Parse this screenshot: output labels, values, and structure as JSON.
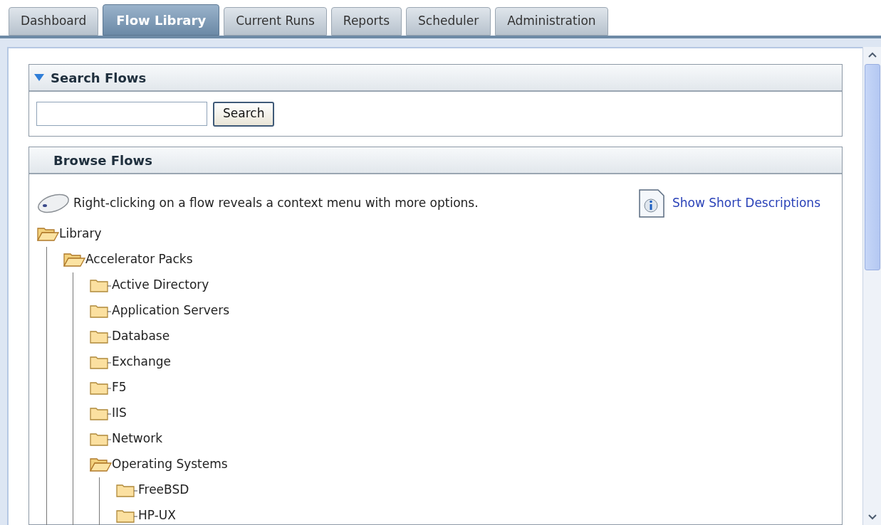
{
  "tabs": [
    {
      "label": "Dashboard",
      "selected": false
    },
    {
      "label": "Flow Library",
      "selected": true
    },
    {
      "label": "Current Runs",
      "selected": false
    },
    {
      "label": "Reports",
      "selected": false
    },
    {
      "label": "Scheduler",
      "selected": false
    },
    {
      "label": "Administration",
      "selected": false
    }
  ],
  "search_panel": {
    "title": "Search Flows",
    "expanded": true,
    "button": "Search"
  },
  "browse_panel": {
    "title": "Browse Flows",
    "hint": "Right-clicking on a flow reveals a context menu with more options.",
    "link": "Show Short Descriptions",
    "tree": [
      {
        "label": "Library",
        "expanded": true,
        "children": [
          {
            "label": "Accelerator Packs",
            "expanded": true,
            "children": [
              {
                "label": "Active Directory",
                "expanded": false
              },
              {
                "label": "Application Servers",
                "expanded": false
              },
              {
                "label": "Database",
                "expanded": false
              },
              {
                "label": "Exchange",
                "expanded": false
              },
              {
                "label": "F5",
                "expanded": false
              },
              {
                "label": "IIS",
                "expanded": false
              },
              {
                "label": "Network",
                "expanded": false
              },
              {
                "label": "Operating Systems",
                "expanded": true,
                "children": [
                  {
                    "label": "FreeBSD",
                    "expanded": false
                  },
                  {
                    "label": "HP-UX",
                    "expanded": false
                  }
                ]
              }
            ]
          }
        ]
      }
    ]
  }
}
